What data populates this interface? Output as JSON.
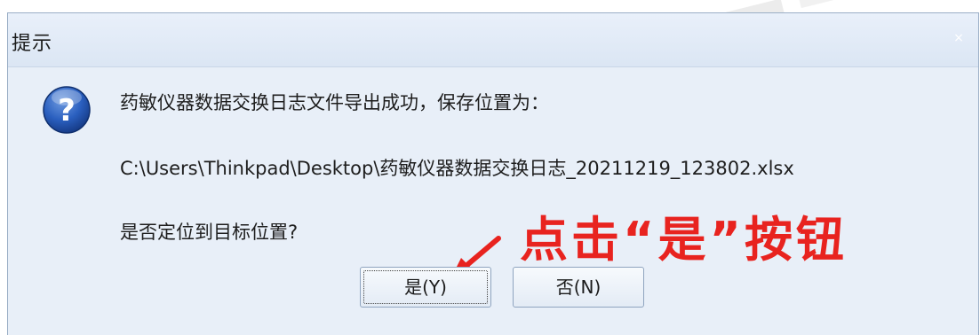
{
  "dialog": {
    "title": "提示",
    "close_glyph": "×",
    "icon": "question-icon",
    "message_line1": "药敏仪器数据交换日志文件导出成功，保存位置为：",
    "message_line2": "C:\\Users\\Thinkpad\\Desktop\\药敏仪器数据交换日志_20211219_123802.xlsx",
    "message_line3": "是否定位到目标位置?",
    "buttons": {
      "yes_label": "是(Y)",
      "no_label": "否(N)"
    }
  },
  "annotation": {
    "text": "点击“是”按钮",
    "color": "#e8231f"
  },
  "colors": {
    "dialog_bg": "#e8eff8",
    "titlebar_bg": "#dbe6f4",
    "border": "#9aaec6"
  }
}
